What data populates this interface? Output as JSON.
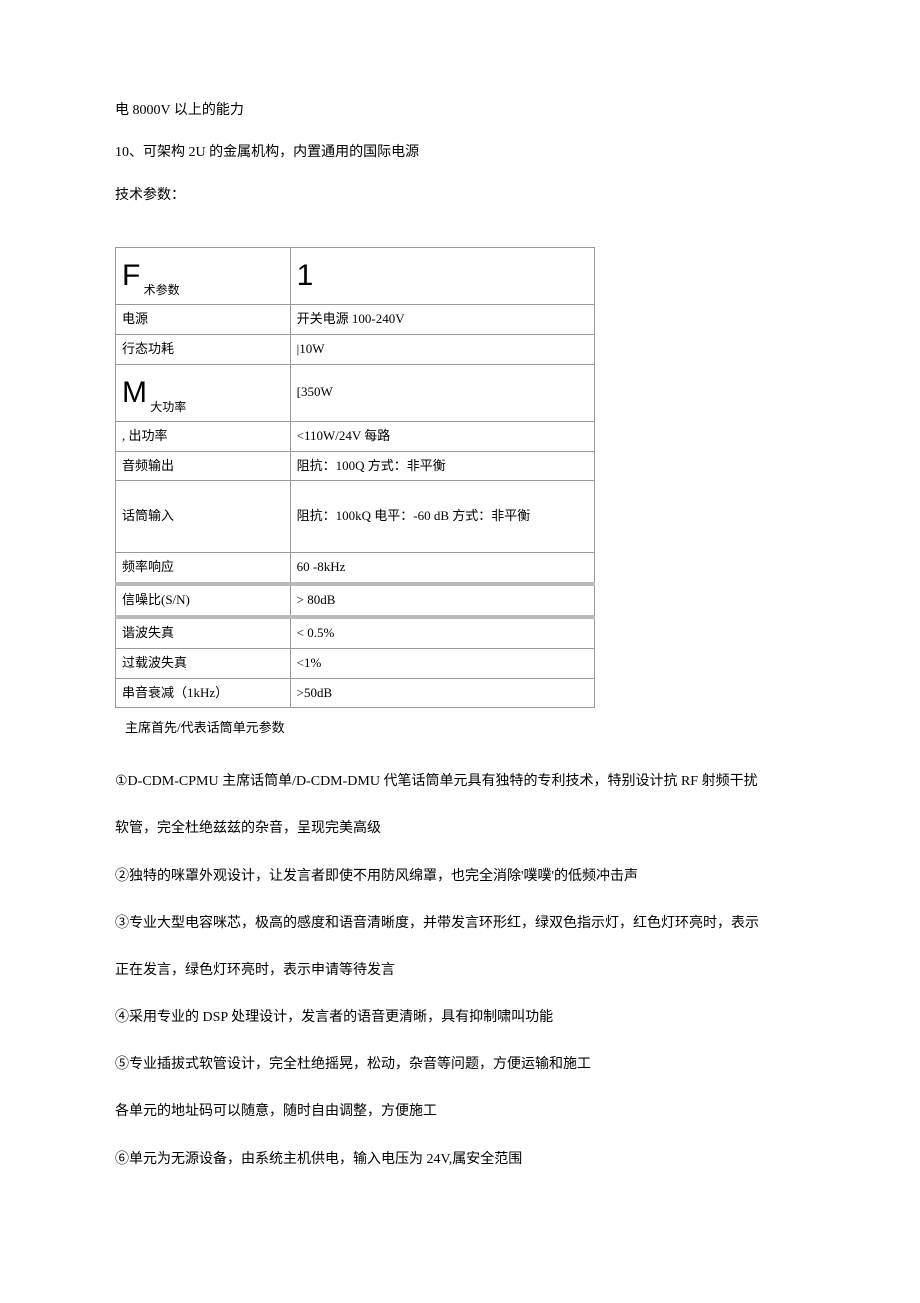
{
  "intro": {
    "line1": "电 8000V 以上的能力",
    "line2": "10、可架构 2U 的金属机构，内置通用的国际电源",
    "label": "技术参数："
  },
  "table": {
    "header_prefix": "F",
    "header_suffix": "术参数",
    "header_right": "1",
    "rows": [
      {
        "label": "电源",
        "value": "开关电源 100-240V"
      },
      {
        "label": "行态功耗",
        "value": "|10W"
      },
      {
        "label_prefix": "M",
        "label_suffix": "大功率",
        "value": "[350W"
      },
      {
        "label": ", 出功率",
        "value": "<110W/24V 每路"
      },
      {
        "label": "音频输出",
        "value": "阻抗：100Q 方式：非平衡"
      },
      {
        "label": "话筒输入",
        "value": "阻抗：100kQ 电平：-60 dB 方式：非平衡"
      },
      {
        "label": "频率响应",
        "value": "60 -8kHz"
      },
      {
        "label": "信噪比(S/N)",
        "value": "> 80dB"
      },
      {
        "label": "谐波失真",
        "value": "< 0.5%"
      },
      {
        "label": "过载波失真",
        "value": "<1%"
      },
      {
        "label": "串音衰减（1kHz）",
        "value": ">50dB"
      }
    ]
  },
  "caption": "主席首先/代表话筒单元参数",
  "paragraphs": [
    "①D-CDM-CPMU 主席话筒单/D-CDM-DMU 代笔话筒单元具有独特的专利技术，特别设计抗 RF 射频干扰",
    "软管，完全杜绝兹兹的杂音，呈现完美高级",
    "②独特的咪罩外观设计，让发言者即使不用防风绵罩，也完全消除'噗噗'的低频冲击声",
    "③专业大型电容咪芯，极高的感度和语音清晰度，并带发言环形红，绿双色指示灯，红色灯环亮时，表示",
    "正在发言，绿色灯环亮时，表示申请等待发言",
    "④采用专业的 DSP 处理设计，发言者的语音更清晰，具有抑制啸叫功能",
    "⑤专业插拔式软管设计，完全杜绝摇晃，松动，杂音等问题，方便运输和施工",
    "各单元的地址码可以随意，随时自由调整，方便施工",
    "⑥单元为无源设备，由系统主机供电，输入电压为 24V,属安全范围"
  ]
}
